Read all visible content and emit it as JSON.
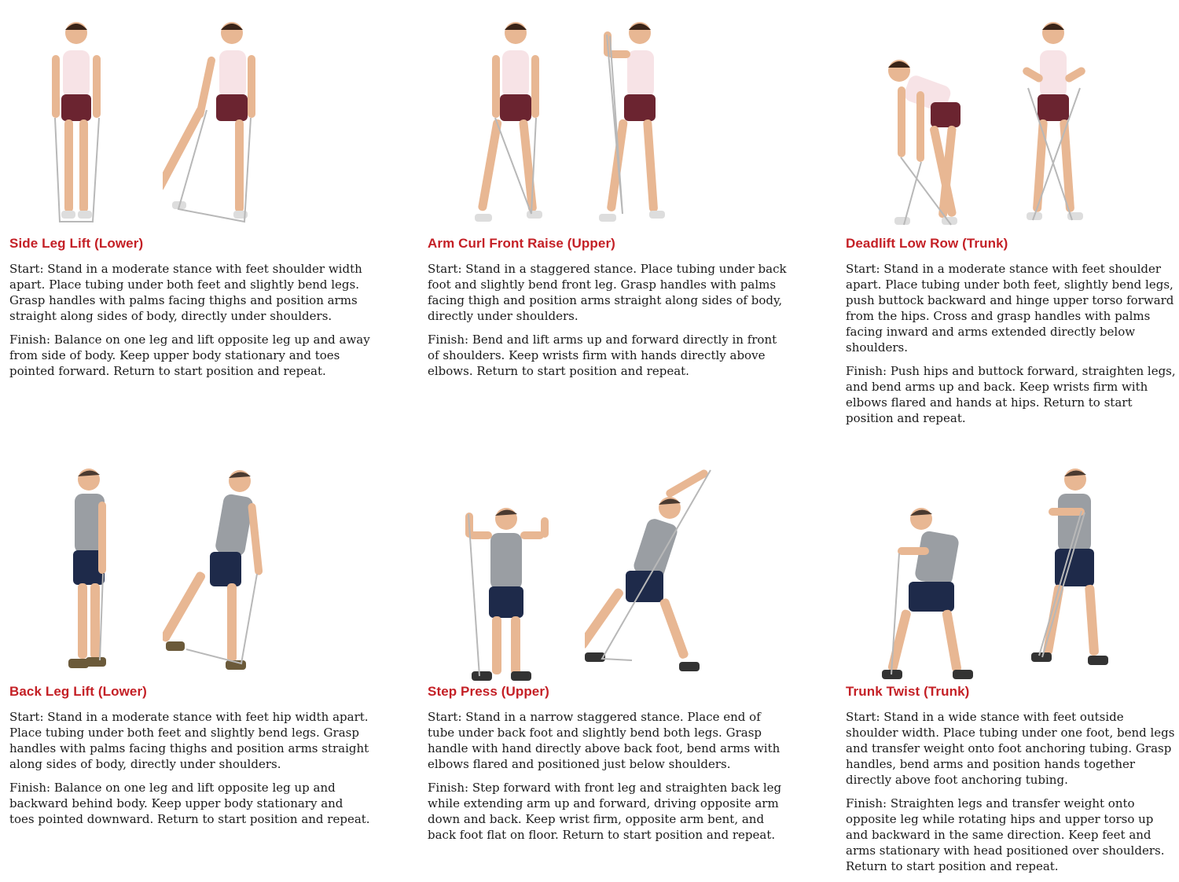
{
  "exercises": [
    {
      "title": "Side Leg Lift (Lower)",
      "start": "Start: Stand in a moderate stance with feet shoulder width apart. Place tubing under both feet and slightly bend legs. Grasp handles with palms facing thighs and position arms straight along sides of body, directly under shoulders.",
      "finish": "Finish: Balance on one leg and lift opposite leg up and away from side of body. Keep upper body stationary and toes pointed forward. Return to start position and repeat."
    },
    {
      "title": "Arm Curl Front Raise (Upper)",
      "start": "Start: Stand in a staggered stance. Place tubing under back foot and slightly bend front leg. Grasp handles with palms facing thigh and position arms straight along sides of body, directly under shoulders.",
      "finish": "Finish: Bend and lift arms up and forward directly in front of shoulders. Keep wrists firm with hands directly above elbows. Return to start position and repeat."
    },
    {
      "title": "Deadlift Low Row (Trunk)",
      "start": "Start: Stand in a moderate stance with feet shoulder apart. Place tubing under both feet, slightly bend legs, push buttock backward and hinge upper torso forward from the hips. Cross and grasp handles with palms facing inward and arms extended directly below shoulders.",
      "finish": "Finish: Push hips and buttock forward, straighten legs, and bend arms up and back. Keep wrists firm with elbows flared and hands at hips. Return to start position and repeat."
    },
    {
      "title": "Back Leg Lift (Lower)",
      "start": "Start: Stand in a moderate stance with feet hip width apart. Place tubing under both feet and slightly bend legs. Grasp handles with palms facing thighs and position arms straight along sides of body, directly under shoulders.",
      "finish": "Finish: Balance on one leg and lift opposite leg up and backward behind body. Keep upper body stationary and toes pointed downward. Return to start position and repeat."
    },
    {
      "title": "Step Press (Upper)",
      "start": "Start: Stand in a narrow staggered stance. Place end of tube under back foot and slightly bend both legs. Grasp handle with hand directly above back foot, bend arms with elbows flared and positioned just below shoulders.",
      "finish": "Finish: Step forward with front leg and straighten back leg while extending arm up and forward, driving opposite arm down and back. Keep wrist firm, opposite arm bent, and back foot flat on floor. Return to start position and repeat."
    },
    {
      "title": "Trunk Twist (Trunk)",
      "start": "Start: Stand in a wide stance with feet outside shoulder width. Place tubing under one foot, bend legs and transfer weight onto foot anchoring tubing. Grasp handles, bend arms and position hands together directly above foot anchoring tubing.",
      "finish": "Finish: Straighten legs and transfer weight onto opposite leg while rotating hips and upper torso up and backward in the same direction. Keep feet and arms stationary with head positioned over shoulders. Return to start position and repeat."
    }
  ],
  "colors": {
    "title": "#c42026",
    "woman_top": "#f7e3e6",
    "woman_shorts": "#6b2430",
    "man_shirt": "#9a9ea3",
    "man_shorts": "#1e2a4a",
    "skin": "#e8b793",
    "tube": "#b8b8b8"
  }
}
